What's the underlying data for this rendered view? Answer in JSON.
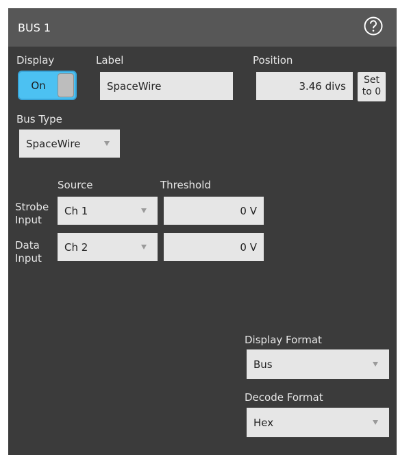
{
  "window": {
    "title": "BUS 1",
    "help_icon": "help-circle-icon"
  },
  "display": {
    "label": "Display",
    "toggle_text": "On",
    "state": true
  },
  "label_field": {
    "label": "Label",
    "value": "SpaceWire"
  },
  "position": {
    "label": "Position",
    "value": "3.46 divs",
    "set_button_line1": "Set",
    "set_button_line2": "to 0"
  },
  "bus_type": {
    "label": "Bus Type",
    "value": "SpaceWire"
  },
  "inputs": {
    "source_header": "Source",
    "threshold_header": "Threshold",
    "rows": [
      {
        "label_line1": "Strobe",
        "label_line2": "Input",
        "source": "Ch 1",
        "threshold": "0 V"
      },
      {
        "label_line1": "Data",
        "label_line2": "Input",
        "source": "Ch 2",
        "threshold": "0 V"
      }
    ]
  },
  "display_format": {
    "label": "Display Format",
    "value": "Bus"
  },
  "decode_format": {
    "label": "Decode Format",
    "value": "Hex"
  },
  "colors": {
    "accent": "#4cc1f2",
    "panel_bg": "#3b3b3b",
    "titlebar_bg": "#575757",
    "field_bg": "#e6e6e6"
  }
}
